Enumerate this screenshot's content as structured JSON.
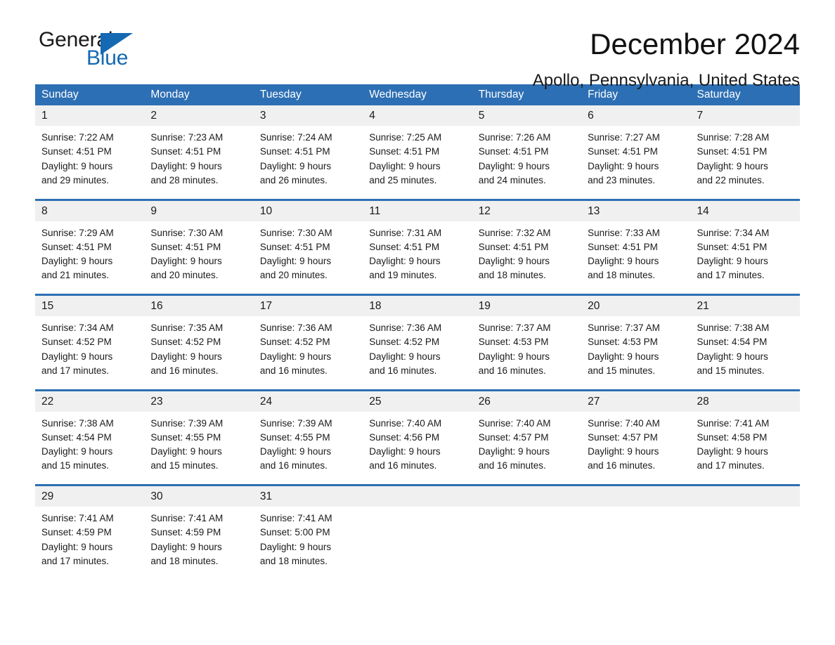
{
  "logo": {
    "word1": "General",
    "word2": "Blue",
    "accent_color": "#1569b2",
    "triangle_icon": "triangle-icon"
  },
  "header": {
    "month_title": "December 2024",
    "location": "Apollo, Pennsylvania, United States"
  },
  "calendar": {
    "header_color": "#2d6fb4",
    "day_band_color": "#f0f0f0",
    "weekday_headers": [
      "Sunday",
      "Monday",
      "Tuesday",
      "Wednesday",
      "Thursday",
      "Friday",
      "Saturday"
    ],
    "weeks": [
      {
        "days": [
          {
            "date": "1",
            "sunrise": "Sunrise: 7:22 AM",
            "sunset": "Sunset: 4:51 PM",
            "daylight_1": "Daylight: 9 hours",
            "daylight_2": "and 29 minutes."
          },
          {
            "date": "2",
            "sunrise": "Sunrise: 7:23 AM",
            "sunset": "Sunset: 4:51 PM",
            "daylight_1": "Daylight: 9 hours",
            "daylight_2": "and 28 minutes."
          },
          {
            "date": "3",
            "sunrise": "Sunrise: 7:24 AM",
            "sunset": "Sunset: 4:51 PM",
            "daylight_1": "Daylight: 9 hours",
            "daylight_2": "and 26 minutes."
          },
          {
            "date": "4",
            "sunrise": "Sunrise: 7:25 AM",
            "sunset": "Sunset: 4:51 PM",
            "daylight_1": "Daylight: 9 hours",
            "daylight_2": "and 25 minutes."
          },
          {
            "date": "5",
            "sunrise": "Sunrise: 7:26 AM",
            "sunset": "Sunset: 4:51 PM",
            "daylight_1": "Daylight: 9 hours",
            "daylight_2": "and 24 minutes."
          },
          {
            "date": "6",
            "sunrise": "Sunrise: 7:27 AM",
            "sunset": "Sunset: 4:51 PM",
            "daylight_1": "Daylight: 9 hours",
            "daylight_2": "and 23 minutes."
          },
          {
            "date": "7",
            "sunrise": "Sunrise: 7:28 AM",
            "sunset": "Sunset: 4:51 PM",
            "daylight_1": "Daylight: 9 hours",
            "daylight_2": "and 22 minutes."
          }
        ]
      },
      {
        "days": [
          {
            "date": "8",
            "sunrise": "Sunrise: 7:29 AM",
            "sunset": "Sunset: 4:51 PM",
            "daylight_1": "Daylight: 9 hours",
            "daylight_2": "and 21 minutes."
          },
          {
            "date": "9",
            "sunrise": "Sunrise: 7:30 AM",
            "sunset": "Sunset: 4:51 PM",
            "daylight_1": "Daylight: 9 hours",
            "daylight_2": "and 20 minutes."
          },
          {
            "date": "10",
            "sunrise": "Sunrise: 7:30 AM",
            "sunset": "Sunset: 4:51 PM",
            "daylight_1": "Daylight: 9 hours",
            "daylight_2": "and 20 minutes."
          },
          {
            "date": "11",
            "sunrise": "Sunrise: 7:31 AM",
            "sunset": "Sunset: 4:51 PM",
            "daylight_1": "Daylight: 9 hours",
            "daylight_2": "and 19 minutes."
          },
          {
            "date": "12",
            "sunrise": "Sunrise: 7:32 AM",
            "sunset": "Sunset: 4:51 PM",
            "daylight_1": "Daylight: 9 hours",
            "daylight_2": "and 18 minutes."
          },
          {
            "date": "13",
            "sunrise": "Sunrise: 7:33 AM",
            "sunset": "Sunset: 4:51 PM",
            "daylight_1": "Daylight: 9 hours",
            "daylight_2": "and 18 minutes."
          },
          {
            "date": "14",
            "sunrise": "Sunrise: 7:34 AM",
            "sunset": "Sunset: 4:51 PM",
            "daylight_1": "Daylight: 9 hours",
            "daylight_2": "and 17 minutes."
          }
        ]
      },
      {
        "days": [
          {
            "date": "15",
            "sunrise": "Sunrise: 7:34 AM",
            "sunset": "Sunset: 4:52 PM",
            "daylight_1": "Daylight: 9 hours",
            "daylight_2": "and 17 minutes."
          },
          {
            "date": "16",
            "sunrise": "Sunrise: 7:35 AM",
            "sunset": "Sunset: 4:52 PM",
            "daylight_1": "Daylight: 9 hours",
            "daylight_2": "and 16 minutes."
          },
          {
            "date": "17",
            "sunrise": "Sunrise: 7:36 AM",
            "sunset": "Sunset: 4:52 PM",
            "daylight_1": "Daylight: 9 hours",
            "daylight_2": "and 16 minutes."
          },
          {
            "date": "18",
            "sunrise": "Sunrise: 7:36 AM",
            "sunset": "Sunset: 4:52 PM",
            "daylight_1": "Daylight: 9 hours",
            "daylight_2": "and 16 minutes."
          },
          {
            "date": "19",
            "sunrise": "Sunrise: 7:37 AM",
            "sunset": "Sunset: 4:53 PM",
            "daylight_1": "Daylight: 9 hours",
            "daylight_2": "and 16 minutes."
          },
          {
            "date": "20",
            "sunrise": "Sunrise: 7:37 AM",
            "sunset": "Sunset: 4:53 PM",
            "daylight_1": "Daylight: 9 hours",
            "daylight_2": "and 15 minutes."
          },
          {
            "date": "21",
            "sunrise": "Sunrise: 7:38 AM",
            "sunset": "Sunset: 4:54 PM",
            "daylight_1": "Daylight: 9 hours",
            "daylight_2": "and 15 minutes."
          }
        ]
      },
      {
        "days": [
          {
            "date": "22",
            "sunrise": "Sunrise: 7:38 AM",
            "sunset": "Sunset: 4:54 PM",
            "daylight_1": "Daylight: 9 hours",
            "daylight_2": "and 15 minutes."
          },
          {
            "date": "23",
            "sunrise": "Sunrise: 7:39 AM",
            "sunset": "Sunset: 4:55 PM",
            "daylight_1": "Daylight: 9 hours",
            "daylight_2": "and 15 minutes."
          },
          {
            "date": "24",
            "sunrise": "Sunrise: 7:39 AM",
            "sunset": "Sunset: 4:55 PM",
            "daylight_1": "Daylight: 9 hours",
            "daylight_2": "and 16 minutes."
          },
          {
            "date": "25",
            "sunrise": "Sunrise: 7:40 AM",
            "sunset": "Sunset: 4:56 PM",
            "daylight_1": "Daylight: 9 hours",
            "daylight_2": "and 16 minutes."
          },
          {
            "date": "26",
            "sunrise": "Sunrise: 7:40 AM",
            "sunset": "Sunset: 4:57 PM",
            "daylight_1": "Daylight: 9 hours",
            "daylight_2": "and 16 minutes."
          },
          {
            "date": "27",
            "sunrise": "Sunrise: 7:40 AM",
            "sunset": "Sunset: 4:57 PM",
            "daylight_1": "Daylight: 9 hours",
            "daylight_2": "and 16 minutes."
          },
          {
            "date": "28",
            "sunrise": "Sunrise: 7:41 AM",
            "sunset": "Sunset: 4:58 PM",
            "daylight_1": "Daylight: 9 hours",
            "daylight_2": "and 17 minutes."
          }
        ]
      },
      {
        "days": [
          {
            "date": "29",
            "sunrise": "Sunrise: 7:41 AM",
            "sunset": "Sunset: 4:59 PM",
            "daylight_1": "Daylight: 9 hours",
            "daylight_2": "and 17 minutes."
          },
          {
            "date": "30",
            "sunrise": "Sunrise: 7:41 AM",
            "sunset": "Sunset: 4:59 PM",
            "daylight_1": "Daylight: 9 hours",
            "daylight_2": "and 18 minutes."
          },
          {
            "date": "31",
            "sunrise": "Sunrise: 7:41 AM",
            "sunset": "Sunset: 5:00 PM",
            "daylight_1": "Daylight: 9 hours",
            "daylight_2": "and 18 minutes."
          },
          {
            "date": "",
            "sunrise": "",
            "sunset": "",
            "daylight_1": "",
            "daylight_2": ""
          },
          {
            "date": "",
            "sunrise": "",
            "sunset": "",
            "daylight_1": "",
            "daylight_2": ""
          },
          {
            "date": "",
            "sunrise": "",
            "sunset": "",
            "daylight_1": "",
            "daylight_2": ""
          },
          {
            "date": "",
            "sunrise": "",
            "sunset": "",
            "daylight_1": "",
            "daylight_2": ""
          }
        ]
      }
    ]
  }
}
